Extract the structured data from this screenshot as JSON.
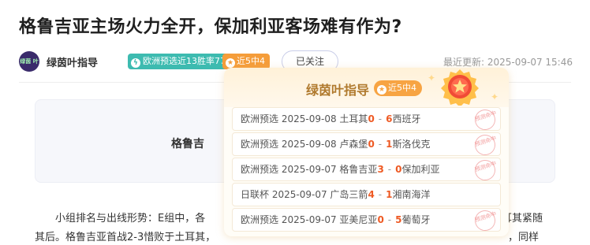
{
  "article": {
    "title": "格鲁吉亚主场火力全开，保加利亚客场难有作为?"
  },
  "author": {
    "avatar_text": "绿茵\n叶指导",
    "name": "绿茵叶指导",
    "stat_icon": "lightning-icon",
    "stat_text": "欧洲预选近13胜率77%",
    "streak_text": "近5中4",
    "follow_label": "已关注",
    "updated_label": "最近更新: 2025-09-07 15:46"
  },
  "match": {
    "home_team": "格鲁吉"
  },
  "body": {
    "para_line1": "小组排名与出线形势：E组中，各",
    "para_line2": "其后。格鲁吉亚首战2-3惜败于土耳其，",
    "para_tail1": "耳其紧随",
    "para_tail2": "，同样"
  },
  "popup": {
    "name": "绿茵叶指导",
    "streak_text": "近5中4",
    "stamp_text": "预测命中",
    "records": [
      {
        "league": "欧洲预选",
        "date": "2025-09-08",
        "home": "土耳其",
        "home_score": "0",
        "away_score": "6",
        "away": "西班牙",
        "hit": true
      },
      {
        "league": "欧洲预选",
        "date": "2025-09-08",
        "home": "卢森堡",
        "home_score": "0",
        "away_score": "1",
        "away": "斯洛伐克",
        "hit": true
      },
      {
        "league": "欧洲预选",
        "date": "2025-09-07",
        "home": "格鲁吉亚",
        "home_score": "3",
        "away_score": "0",
        "away": "保加利亚",
        "hit": true
      },
      {
        "league": "日联杯",
        "date": "2025-09-07",
        "home": "广岛三箭",
        "home_score": "4",
        "away_score": "1",
        "away": "湘南海洋",
        "hit": false
      },
      {
        "league": "欧洲预选",
        "date": "2025-09-07",
        "home": "亚美尼亚",
        "home_score": "0",
        "away_score": "5",
        "away": "葡萄牙",
        "hit": true
      }
    ]
  },
  "colors": {
    "accent_teal": "#3dbbb0",
    "accent_orange": "#f59d3a",
    "score_red": "#ee5a24",
    "popup_title": "#b07a2e"
  }
}
